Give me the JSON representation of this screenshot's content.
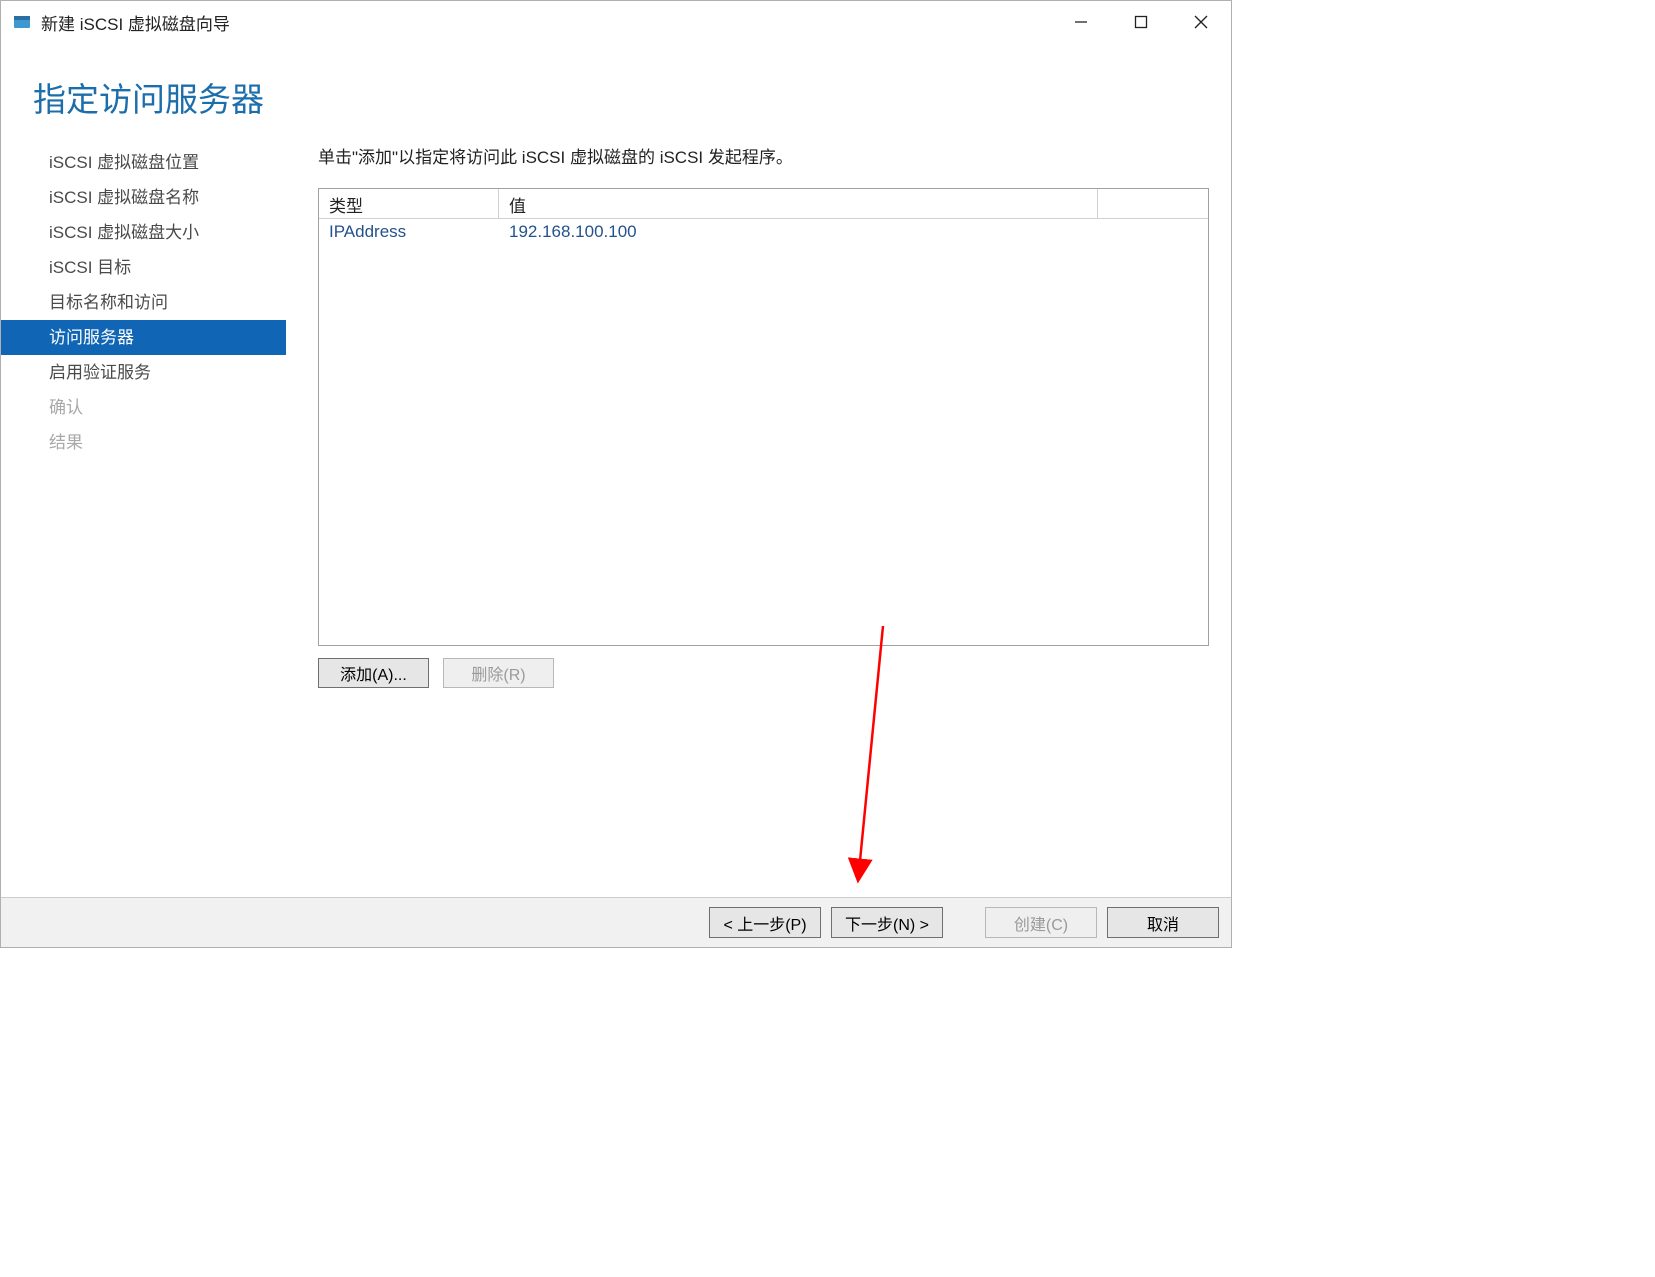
{
  "titlebar": {
    "title": "新建 iSCSI 虚拟磁盘向导"
  },
  "heading": "指定访问服务器",
  "sidebar": {
    "items": [
      {
        "label": "iSCSI 虚拟磁盘位置",
        "state": "normal"
      },
      {
        "label": "iSCSI 虚拟磁盘名称",
        "state": "normal"
      },
      {
        "label": "iSCSI 虚拟磁盘大小",
        "state": "normal"
      },
      {
        "label": "iSCSI 目标",
        "state": "normal"
      },
      {
        "label": "目标名称和访问",
        "state": "normal"
      },
      {
        "label": "访问服务器",
        "state": "active"
      },
      {
        "label": "启用验证服务",
        "state": "normal"
      },
      {
        "label": "确认",
        "state": "disabled"
      },
      {
        "label": "结果",
        "state": "disabled"
      }
    ]
  },
  "content": {
    "instruction": "单击\"添加\"以指定将访问此 iSCSI 虚拟磁盘的 iSCSI 发起程序。",
    "columns": {
      "type": "类型",
      "value": "值"
    },
    "rows": [
      {
        "type": "IPAddress",
        "value": "192.168.100.100"
      }
    ],
    "buttons": {
      "add": "添加(A)...",
      "remove": "删除(R)"
    }
  },
  "footer": {
    "prev": "< 上一步(P)",
    "next": "下一步(N) >",
    "create": "创建(C)",
    "cancel": "取消"
  },
  "annotation": {
    "arrow_color": "#ff0000"
  }
}
